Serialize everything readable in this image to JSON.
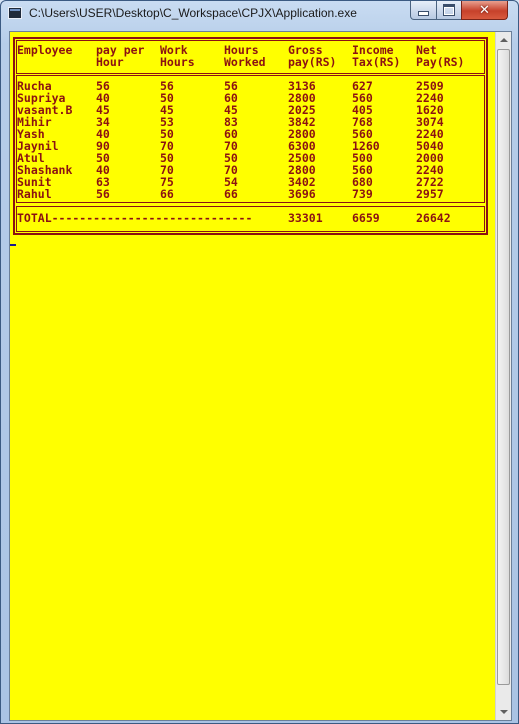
{
  "window": {
    "title": "C:\\Users\\USER\\Desktop\\C_Workspace\\CPJX\\Application.exe",
    "console_bg": "#ffff00",
    "console_fg": "#8b1212"
  },
  "table": {
    "headers": [
      {
        "line1": "Employee",
        "line2": ""
      },
      {
        "line1": "pay per",
        "line2": "Hour"
      },
      {
        "line1": "Work",
        "line2": "Hours"
      },
      {
        "line1": "Hours",
        "line2": "Worked"
      },
      {
        "line1": "Gross",
        "line2": "pay(RS)"
      },
      {
        "line1": "Income",
        "line2": "Tax(RS)"
      },
      {
        "line1": "Net",
        "line2": "Pay(RS)"
      }
    ],
    "rows": [
      [
        "Rucha",
        "56",
        "56",
        "56",
        "3136",
        "627",
        "2509"
      ],
      [
        "Supriya",
        "40",
        "50",
        "60",
        "2800",
        "560",
        "2240"
      ],
      [
        "vasant.B",
        "45",
        "45",
        "45",
        "2025",
        "405",
        "1620"
      ],
      [
        "Mihir",
        "34",
        "53",
        "83",
        "3842",
        "768",
        "3074"
      ],
      [
        "Yash",
        "40",
        "50",
        "60",
        "2800",
        "560",
        "2240"
      ],
      [
        "Jaynil",
        "90",
        "70",
        "70",
        "6300",
        "1260",
        "5040"
      ],
      [
        "Atul",
        "50",
        "50",
        "50",
        "2500",
        "500",
        "2000"
      ],
      [
        "Shashank",
        "40",
        "70",
        "70",
        "2800",
        "560",
        "2240"
      ],
      [
        "Sunit",
        "63",
        "75",
        "54",
        "3402",
        "680",
        "2722"
      ],
      [
        "Rahul",
        "56",
        "66",
        "66",
        "3696",
        "739",
        "2957"
      ]
    ],
    "total": {
      "label": "TOTAL-----------------------------",
      "gross": "33301",
      "tax": "6659",
      "net": "26642"
    }
  }
}
